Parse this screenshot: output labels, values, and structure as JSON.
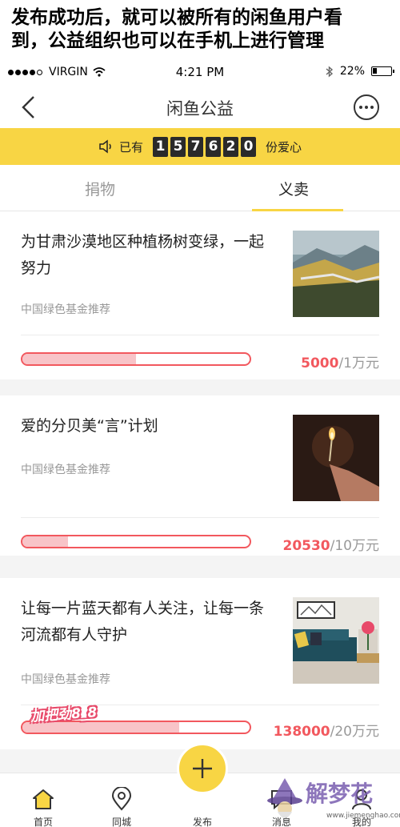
{
  "caption": {
    "line1": "发布成功后，就可以被所有的闲鱼用户看",
    "line2": "到，公益组织也可以在手机上进行管理"
  },
  "status_bar": {
    "carrier": "VIRGIN",
    "time": "4:21 PM",
    "battery": "22%",
    "battery_level": 0.22
  },
  "nav": {
    "title": "闲鱼公益"
  },
  "banner": {
    "prefix": "已有",
    "digits": [
      "1",
      "5",
      "7",
      "6",
      "2",
      "0"
    ],
    "suffix": "份爱心"
  },
  "tabs": [
    {
      "label": "捐物"
    },
    {
      "label": "义卖"
    }
  ],
  "cards": [
    {
      "title": "为甘肃沙漠地区种植杨树变绿，一起努力",
      "org": "中国绿色基金推荐",
      "raised": "5000",
      "target": "/1万元",
      "progress": 0.5
    },
    {
      "title": "爱的分贝美“言”计划",
      "org": "中国绿色基金推荐",
      "raised": "20530",
      "target": "/10万元",
      "progress": 0.2
    },
    {
      "title": "让每一片蓝天都有人关注，让每一条河流都有人守护",
      "org": "中国绿色基金推荐",
      "raised": "138000",
      "target": "/20万元",
      "progress": 0.69
    }
  ],
  "sticker": "加把劲8_8",
  "tabbar": {
    "home": "首页",
    "city": "同城",
    "publish": "发布",
    "messages": "消息",
    "mine": "我的"
  },
  "watermark": {
    "text": "解梦花",
    "url": "www.jiemenghao.com"
  },
  "colors": {
    "brand_yellow": "#f8d544",
    "accent_red": "#f2585e",
    "progress_fill": "#f8c4c8"
  }
}
